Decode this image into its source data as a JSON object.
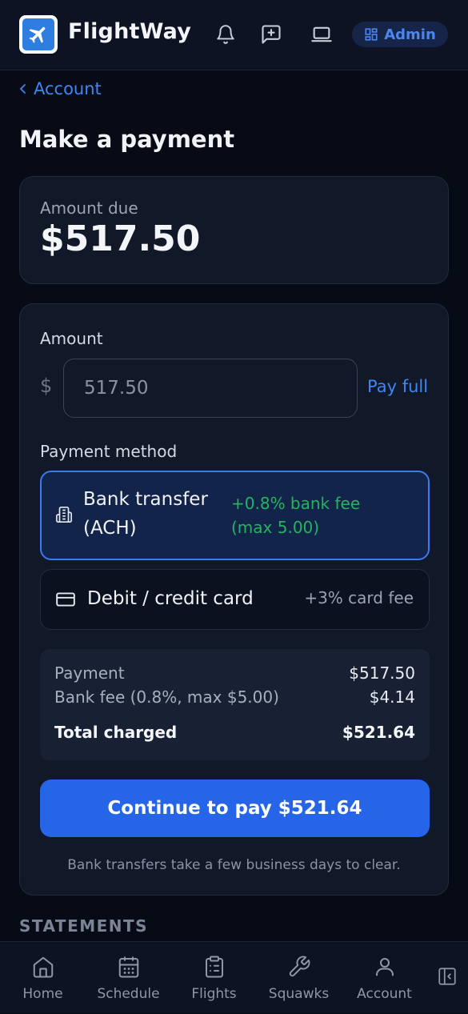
{
  "header": {
    "brand": "FlightWay",
    "admin_label": "Admin"
  },
  "breadcrumb": {
    "back_label": "Account"
  },
  "page": {
    "title": "Make a payment"
  },
  "amount_due": {
    "label": "Amount due",
    "value": "$517.50"
  },
  "payment_form": {
    "amount_label": "Amount",
    "currency_symbol": "$",
    "amount_value": "517.50",
    "pay_full_label": "Pay full",
    "method_label": "Payment method",
    "methods": [
      {
        "title_line1": "Bank transfer",
        "title_line2": "(ACH)",
        "fee_line1": "+0.8% bank fee",
        "fee_line2": "(max 5.00)",
        "selected": true,
        "icon": "bank-icon"
      },
      {
        "title": "Debit / credit card",
        "fee": "+3% card fee",
        "selected": false,
        "icon": "credit-card-icon"
      }
    ],
    "summary": {
      "payment_label": "Payment",
      "payment_value": "$517.50",
      "fee_label": "Bank fee (0.8%, max $5.00)",
      "fee_value": "$4.14",
      "total_label": "Total charged",
      "total_value": "$521.64"
    },
    "continue_label": "Continue to pay $521.64",
    "note": "Bank transfers take a few business days to clear."
  },
  "statements": {
    "heading": "STATEMENTS"
  },
  "bottom_nav": [
    {
      "label": "Home",
      "icon": "home-icon"
    },
    {
      "label": "Schedule",
      "icon": "calendar-icon"
    },
    {
      "label": "Flights",
      "icon": "clipboard-icon"
    },
    {
      "label": "Squawks",
      "icon": "wrench-icon"
    },
    {
      "label": "Account",
      "icon": "user-icon"
    }
  ],
  "colors": {
    "background": "#070b16",
    "card": "#111827",
    "accent": "#2664e8",
    "link": "#3f86f2",
    "fee_green": "#24b35e"
  }
}
